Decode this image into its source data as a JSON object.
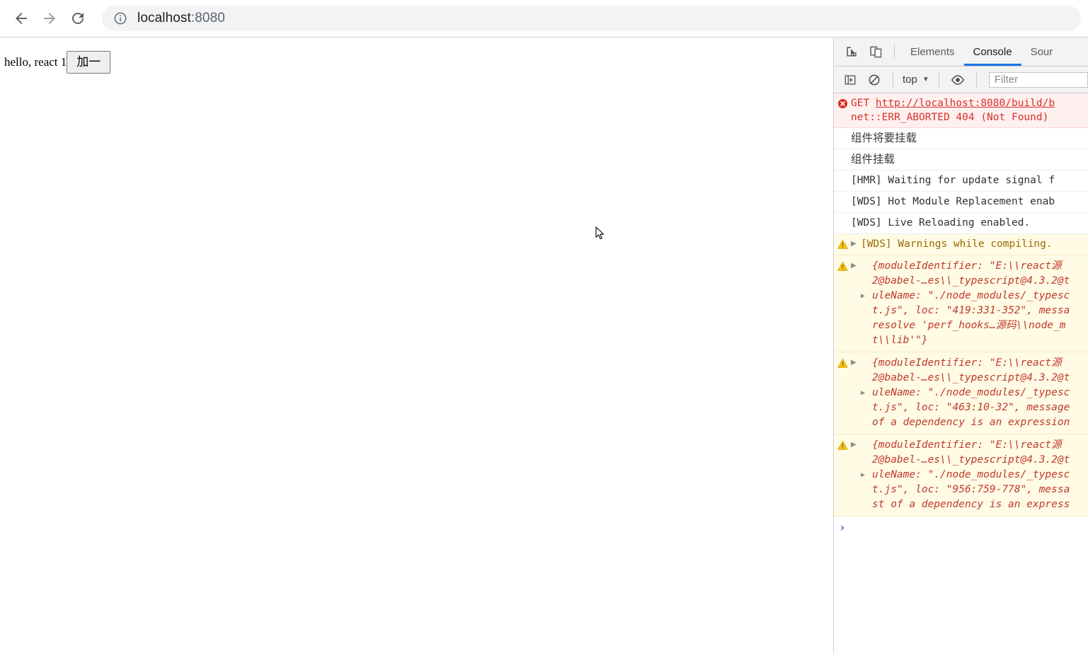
{
  "browser": {
    "back_label": "Back",
    "forward_label": "Forward",
    "reload_label": "Reload",
    "site_info_label": "View site information",
    "url_host": "localhost",
    "url_port": ":8080"
  },
  "page": {
    "text": "hello, react 1",
    "button_label": "加一"
  },
  "devtools": {
    "toolbar": {
      "inspect_label": "Inspect element",
      "device_toolbar_label": "Toggle device toolbar"
    },
    "tabs": [
      {
        "label": "Elements",
        "active": false
      },
      {
        "label": "Console",
        "active": true
      },
      {
        "label": "Sour",
        "active": false
      }
    ],
    "filterbar": {
      "sidebar_toggle_label": "Show console sidebar",
      "clear_label": "Clear console",
      "context": "top",
      "context_caret": "▼",
      "eye_label": "Create live expression",
      "filter_placeholder": "Filter"
    },
    "console_rows": [
      {
        "kind": "error",
        "prefix": "GET ",
        "link": "http://localhost:8080/build/b",
        "tail": "net::ERR_ABORTED 404 (Not Found)"
      },
      {
        "kind": "log",
        "cjk": true,
        "text": "组件将要挂载"
      },
      {
        "kind": "log",
        "cjk": true,
        "text": "组件挂载"
      },
      {
        "kind": "log",
        "text": "[HMR] Waiting for update signal f"
      },
      {
        "kind": "log",
        "text": "[WDS] Hot Module Replacement enab"
      },
      {
        "kind": "log",
        "text": "[WDS] Live Reloading enabled."
      },
      {
        "kind": "warn",
        "disclosure": "▶",
        "text": "[WDS] Warnings while compiling."
      }
    ],
    "warning_blocks": [
      {
        "disclosure": "▶",
        "inner_disclosure": "▶",
        "inner_disclosure_line": 2,
        "lines": [
          "{moduleIdentifier: \"E:\\\\react源",
          "2@babel-…es\\\\_typescript@4.3.2@t",
          "uleName: \"./node_modules/_typesc",
          "t.js\", loc: \"419:331-352\", messa",
          "resolve 'perf_hooks…源码\\\\node_m",
          "t\\\\lib'\"}"
        ]
      },
      {
        "disclosure": "▶",
        "inner_disclosure": "▶",
        "inner_disclosure_line": 2,
        "lines": [
          "{moduleIdentifier: \"E:\\\\react源",
          "2@babel-…es\\\\_typescript@4.3.2@t",
          "uleName: \"./node_modules/_typesc",
          "t.js\", loc: \"463:10-32\", message",
          "of a dependency is an expression"
        ]
      },
      {
        "disclosure": "▶",
        "inner_disclosure": "▶",
        "inner_disclosure_line": 2,
        "lines": [
          "{moduleIdentifier: \"E:\\\\react源",
          "2@babel-…es\\\\_typescript@4.3.2@t",
          "uleName: \"./node_modules/_typesc",
          "t.js\", loc: \"956:759-778\", messa",
          "st of a dependency is an express"
        ]
      }
    ],
    "prompt_caret": "›"
  },
  "colors": {
    "accent": "#1a73e8",
    "error": "#d93025",
    "warning": "#9a6a00",
    "warning_bg": "#fffbe5",
    "error_bg": "#fff0f0"
  }
}
